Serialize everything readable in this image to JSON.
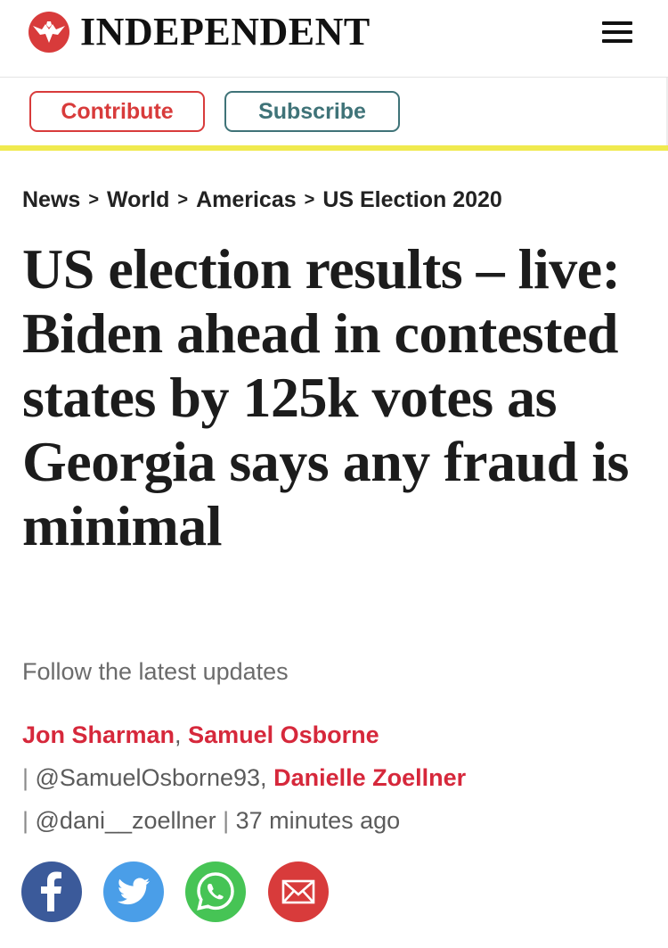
{
  "header": {
    "logo_text": "INDEPENDENT",
    "logo_icon": "eagle-logo-icon",
    "menu_icon": "hamburger-menu-icon",
    "logo_color": "#d83b3b"
  },
  "support": {
    "contribute_label": "Contribute",
    "subscribe_label": "Subscribe",
    "contribute_color": "#d83b3b",
    "subscribe_color": "#3f7378",
    "rule_color": "#f0ea4f"
  },
  "breadcrumb": {
    "items": [
      {
        "label": "News"
      },
      {
        "label": "World"
      },
      {
        "label": "Americas"
      },
      {
        "label": "US Election 2020"
      }
    ],
    "separator": ">"
  },
  "article": {
    "headline": "US election results – live: Biden ahead in contested states by 125k votes as Georgia says any fraud is minimal",
    "standfirst": "Follow the latest updates"
  },
  "byline": {
    "author_1": "Jon Sharman",
    "comma_1": ", ",
    "author_2": "Samuel Osborne",
    "pipe_1": "|",
    "handle_2": " @SamuelOsborne93, ",
    "author_3": "Danielle Zoellner",
    "pipe_2": "|",
    "handle_3": " @dani__zoellner ",
    "pipe_3": "|",
    "time": " 37 minutes ago",
    "author_color": "#d6283b"
  },
  "share": {
    "icons": [
      "facebook-icon",
      "twitter-icon",
      "whatsapp-icon",
      "email-icon"
    ],
    "colors": [
      "#3b5a9a",
      "#4a9ee8",
      "#46c455",
      "#d83b3b"
    ]
  }
}
